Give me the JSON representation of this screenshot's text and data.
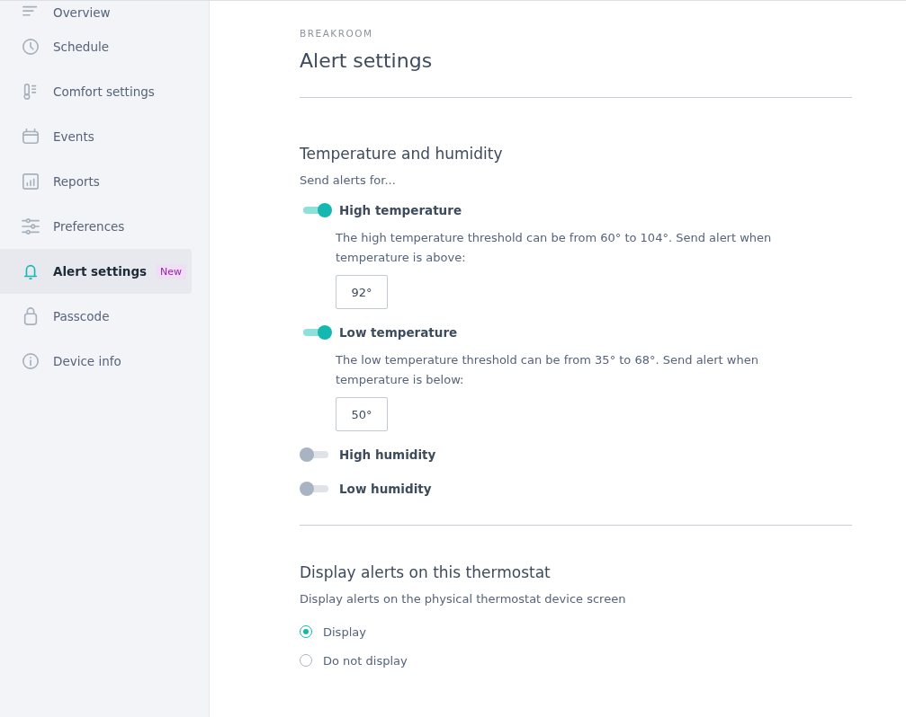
{
  "sidebar": {
    "items": [
      {
        "label": "Overview",
        "selected": false
      },
      {
        "label": "Schedule",
        "selected": false
      },
      {
        "label": "Comfort settings",
        "selected": false
      },
      {
        "label": "Events",
        "selected": false
      },
      {
        "label": "Reports",
        "selected": false
      },
      {
        "label": "Preferences",
        "selected": false
      },
      {
        "label": "Alert settings",
        "selected": true,
        "badge": "New"
      },
      {
        "label": "Passcode",
        "selected": false
      },
      {
        "label": "Device info",
        "selected": false
      }
    ]
  },
  "header": {
    "eyebrow": "BREAKROOM",
    "title": "Alert settings"
  },
  "temperature_section": {
    "title": "Temperature and humidity",
    "subtitle": "Send alerts for...",
    "alerts": [
      {
        "label": "High temperature",
        "on": true,
        "description": "The high temperature threshold can be from 60° to 104°. Send alert when temperature is above:",
        "value": "92°"
      },
      {
        "label": "Low temperature",
        "on": true,
        "description": "The low temperature threshold can be from 35° to 68°. Send alert when temperature is below:",
        "value": "50°"
      },
      {
        "label": "High humidity",
        "on": false
      },
      {
        "label": "Low humidity",
        "on": false
      }
    ]
  },
  "display_section": {
    "title": "Display alerts on this thermostat",
    "subtitle": "Display alerts on the physical thermostat device screen",
    "options": [
      {
        "label": "Display",
        "selected": true
      },
      {
        "label": "Do not display",
        "selected": false
      }
    ]
  }
}
